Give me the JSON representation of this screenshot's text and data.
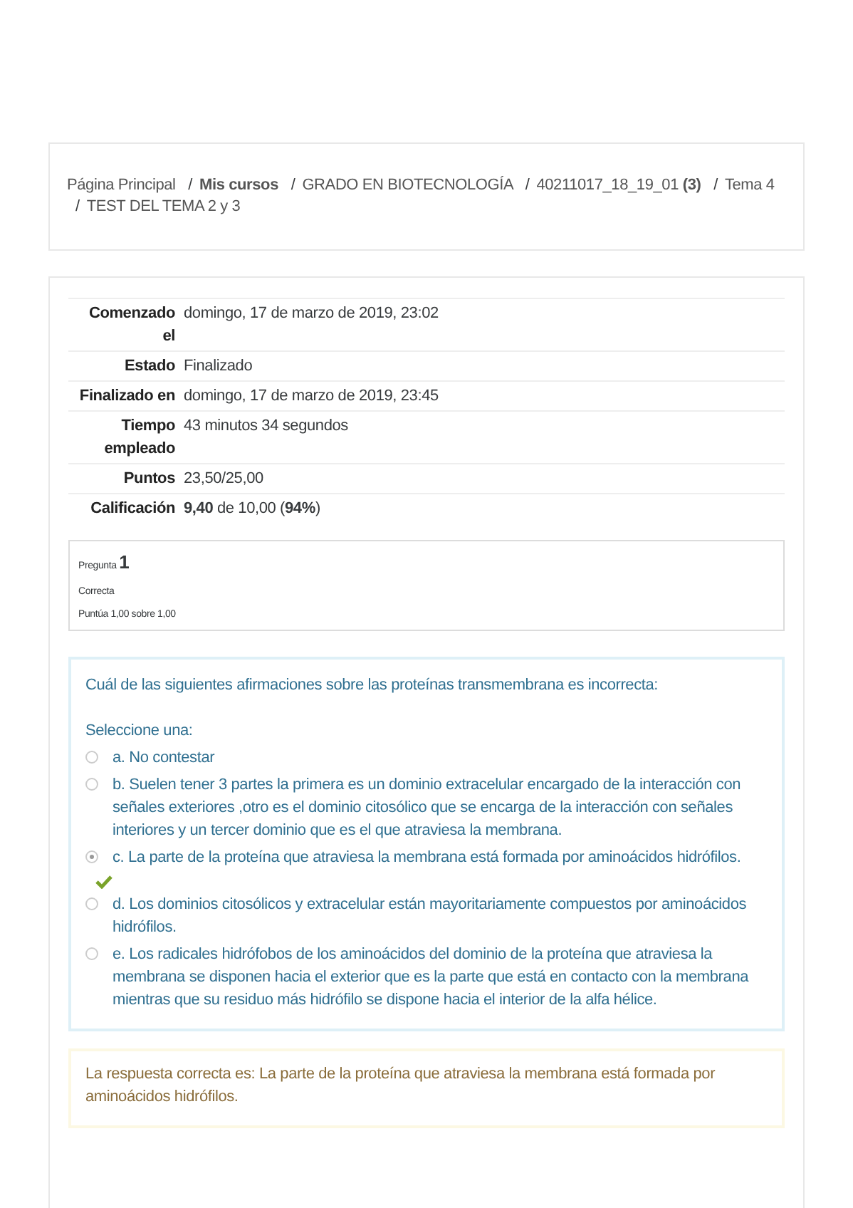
{
  "breadcrumb": {
    "separator": "/",
    "items": [
      {
        "text": "Página Principal"
      },
      {
        "text": "**Mis cursos**"
      },
      {
        "text": "GRADO EN BIOTECNOLOGÍA"
      },
      {
        "text": "40211017_18_19_01 **(3)**"
      },
      {
        "text": "Tema 4"
      },
      {
        "text": "TEST DEL TEMA 2 y 3"
      }
    ]
  },
  "summary": [
    {
      "label": "Comenzado el",
      "value": "domingo, 17 de marzo de 2019, 23:02"
    },
    {
      "label": "Estado",
      "value": "Finalizado"
    },
    {
      "label": "Finalizado en",
      "value": "domingo, 17 de marzo de 2019, 23:45"
    },
    {
      "label": "Tiempo empleado",
      "value": "43 minutos 34 segundos"
    },
    {
      "label": "Puntos",
      "value": "23,50/25,00"
    },
    {
      "label": "Calificación",
      "value": "**9,40** de 10,00 (**94%**)"
    }
  ],
  "question": {
    "label": "Pregunta",
    "number": "1",
    "state": "Correcta",
    "grade": "Puntúa 1,00 sobre 1,00",
    "text": "Cuál de las siguientes afirmaciones sobre las proteínas transmembrana es incorrecta:",
    "prompt": "Seleccione una:",
    "options": [
      {
        "text": "a. No contestar",
        "selected": false,
        "correct": false
      },
      {
        "text": "b. Suelen tener 3 partes la primera es un dominio extracelular encargado de la interacción con señales exteriores ,otro es el dominio citosólico que se encarga de la interacción con señales interiores y un tercer dominio que es el que atraviesa la membrana.",
        "selected": false,
        "correct": false
      },
      {
        "text": "c. La parte de la proteína que atraviesa la membrana está formada por aminoácidos hidrófilos.",
        "selected": true,
        "correct": true
      },
      {
        "text": "d. Los dominios citosólicos y extracelular están mayoritariamente compuestos por aminoácidos hidrófilos.",
        "selected": false,
        "correct": false
      },
      {
        "text": "e. Los radicales hidrófobos de los aminoácidos del dominio de la proteína que atraviesa la membrana se disponen hacia el exterior que es la parte que está en contacto con la membrana mientras que su residuo más hidrófilo se dispone hacia el interior de la alfa hélice.",
        "selected": false,
        "correct": false
      }
    ],
    "feedback": "La respuesta correcta es: La parte de la proteína que atraviesa la membrana está formada por aminoácidos hidrófilos."
  }
}
